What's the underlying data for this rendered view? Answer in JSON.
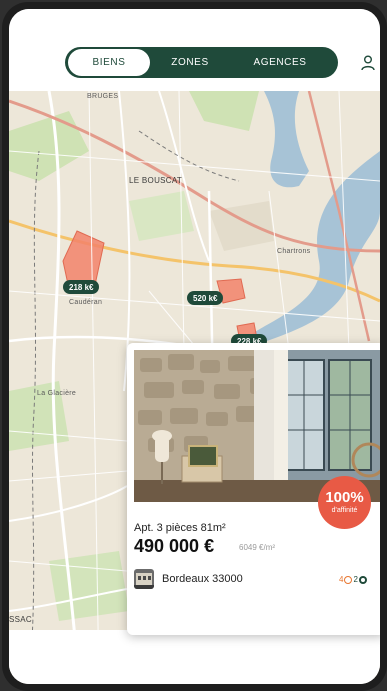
{
  "tabs": {
    "active": "BIENS",
    "items": [
      "BIENS",
      "ZONES",
      "AGENCES"
    ]
  },
  "map": {
    "labels": {
      "bruges": "BRUGES",
      "le_bouscat": "LE BOUSCAT",
      "la_glaciere": "La Glacière",
      "ssac": "SSAC",
      "chartrons": "Chartrons",
      "caudéran": "Caudéran"
    },
    "pins": [
      {
        "id": "pin-1",
        "label": "218 k€"
      },
      {
        "id": "pin-2",
        "label": "520 k€"
      },
      {
        "id": "pin-3",
        "label": "228 k€"
      }
    ]
  },
  "card": {
    "affinity_percent": "100%",
    "affinity_label": "d'affinité",
    "type": "Apt. 3 pièces 81m²",
    "price": "490 000 €",
    "price_per_m2": "6049 €/m²",
    "city": "Bordeaux 33000",
    "badge_left_count": "4",
    "badge_right_count": "2"
  },
  "colors": {
    "brand_green": "#1f4a3a",
    "accent_red": "#e85a45",
    "map_bg": "#ede7d9",
    "water": "#a7c3d6"
  },
  "icons": {
    "user": "user-icon",
    "affinity": "affinity-badge",
    "rating": "ring-icon",
    "coin": "coin-icon"
  }
}
